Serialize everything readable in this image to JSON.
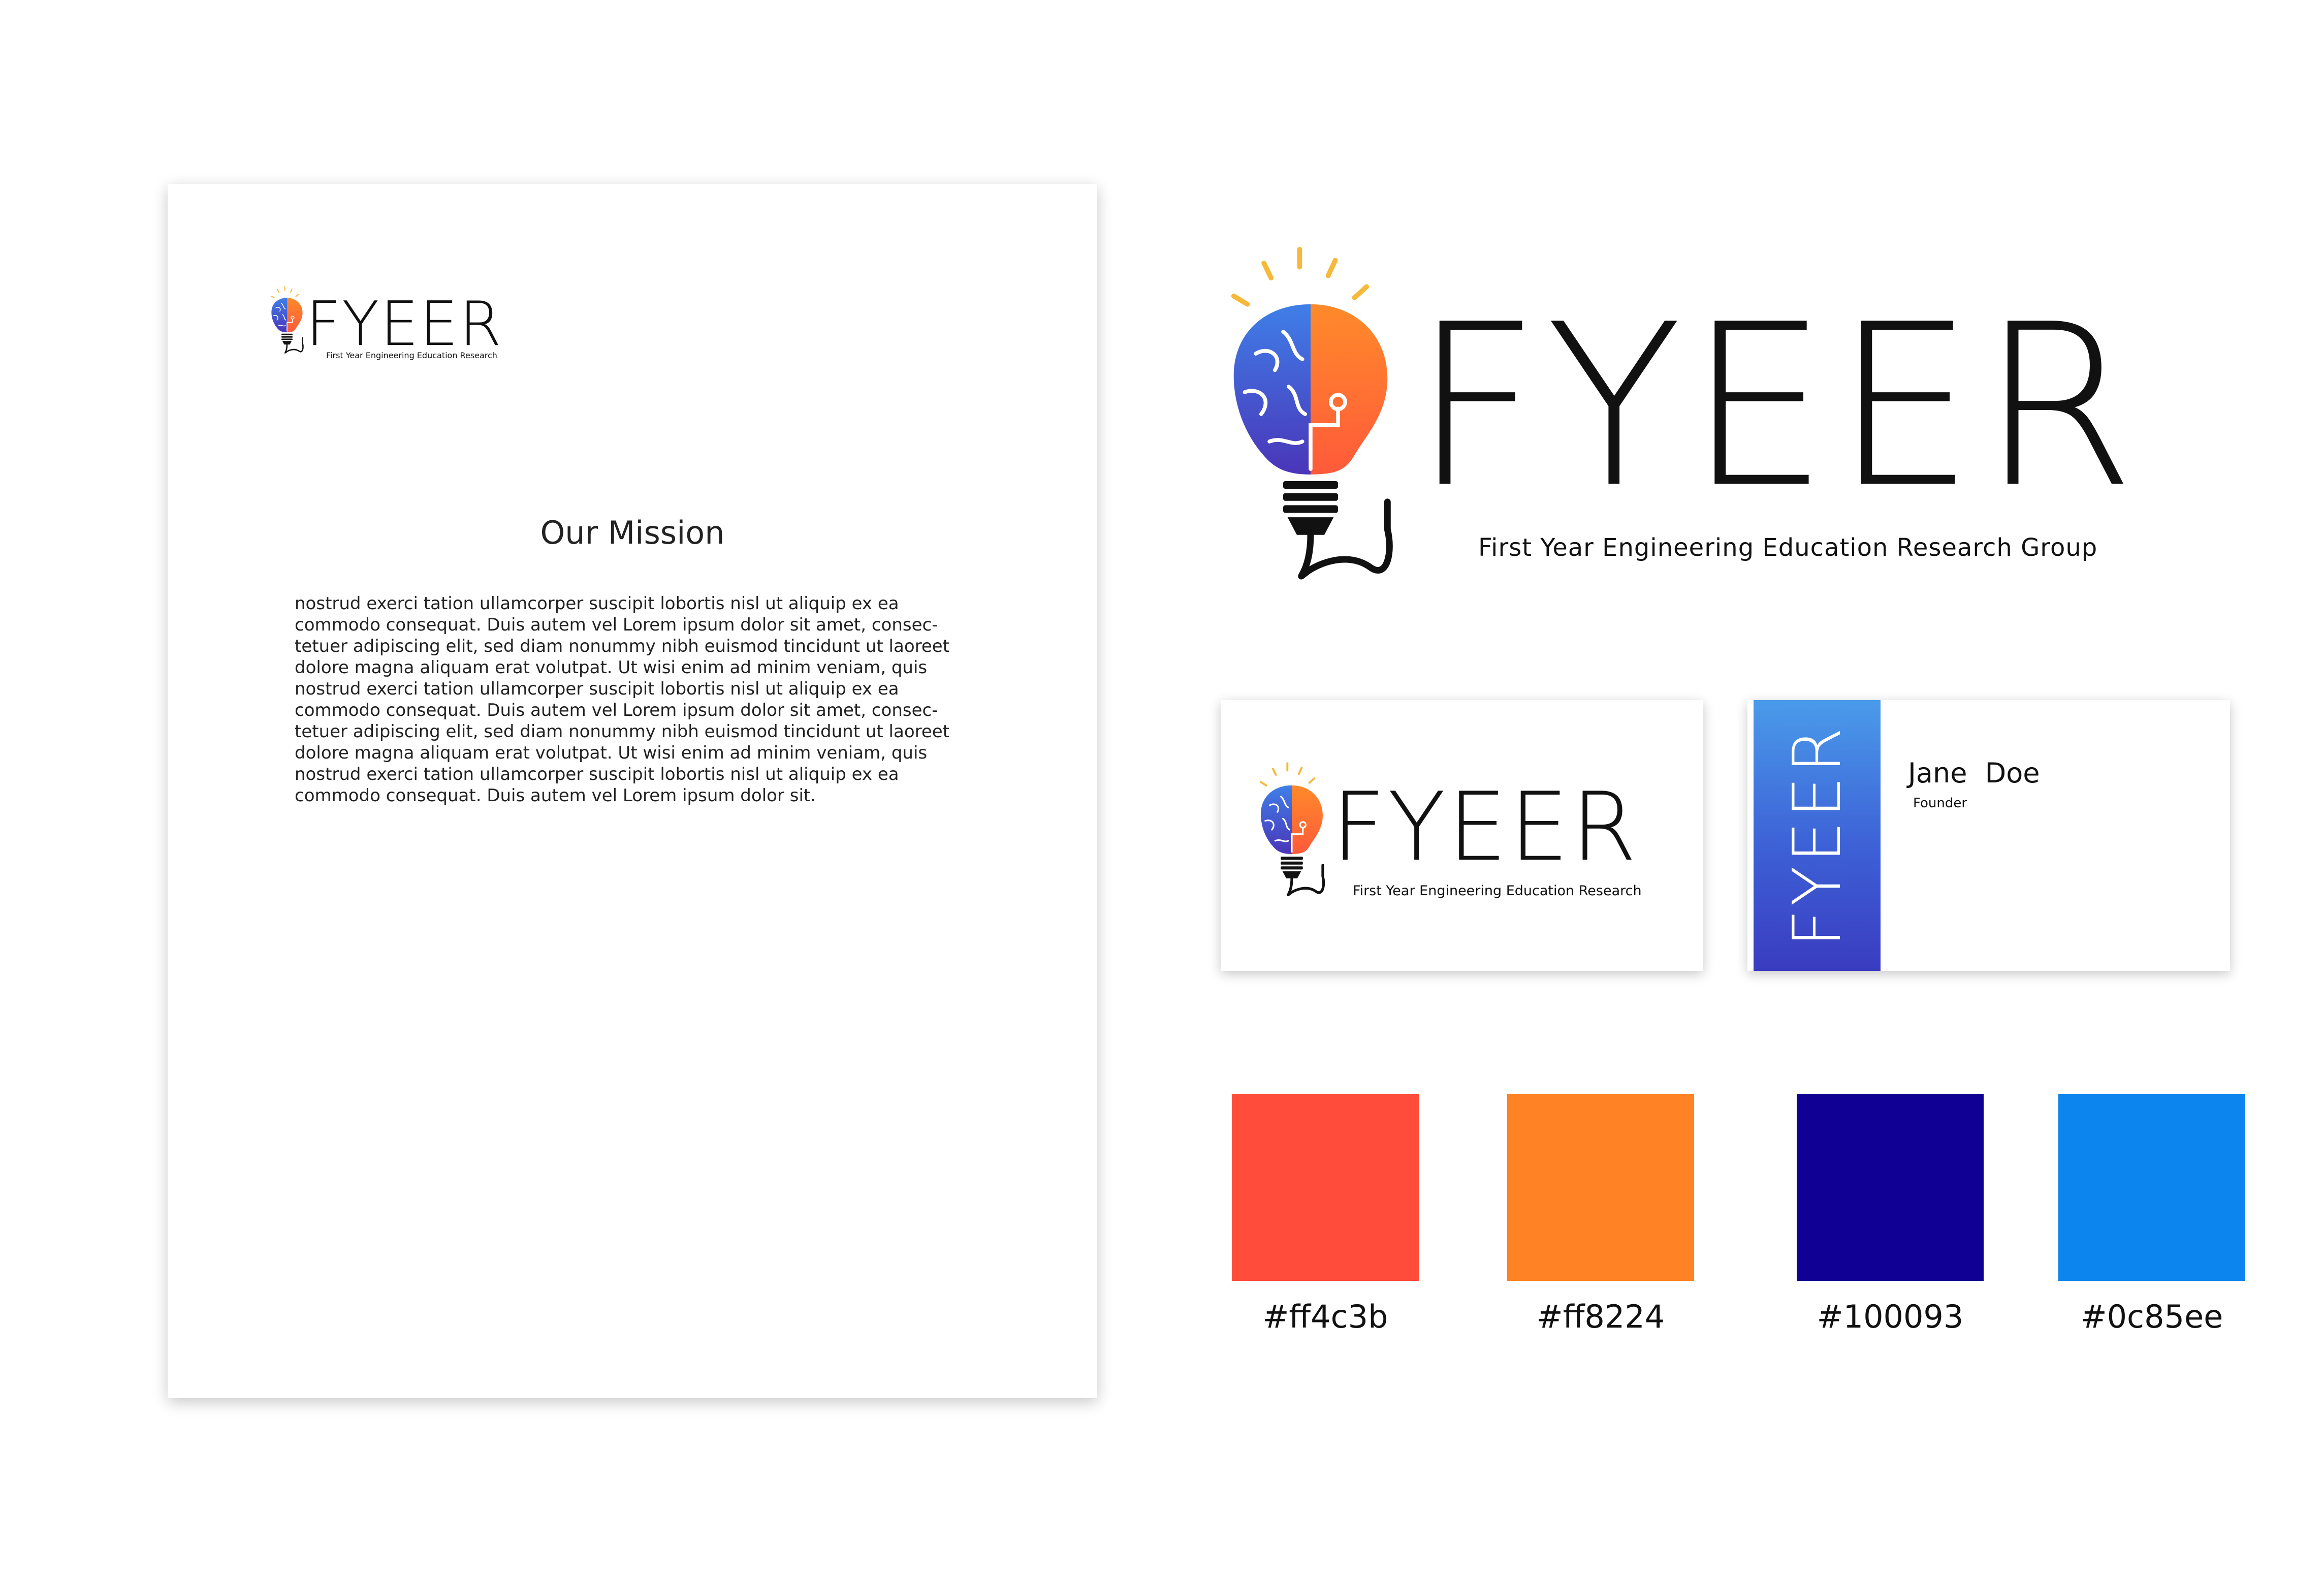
{
  "brand": {
    "logo_word": "FYEER",
    "tagline_full": "First Year Engineering Education Research Group",
    "tagline_short": "First Year Engineering Education Research"
  },
  "letterhead": {
    "title": "Our Mission",
    "body_lines": [
      "nostrud exerci tation ullamcorper suscipit lobortis nisl ut aliquip ex ea",
      "commodo consequat. Duis autem vel Lorem ipsum dolor sit amet, consec-",
      "tetuer adipiscing elit, sed diam nonummy nibh euismod tincidunt ut laoreet",
      "dolore magna aliquam erat volutpat. Ut wisi enim ad minim veniam, quis",
      "nostrud exerci tation ullamcorper suscipit lobortis nisl ut aliquip ex ea",
      "commodo consequat. Duis autem vel Lorem ipsum dolor sit amet, consec-",
      "tetuer adipiscing elit, sed diam nonummy nibh euismod tincidunt ut laoreet",
      "dolore magna aliquam erat volutpat. Ut wisi enim ad minim veniam, quis",
      "nostrud exerci tation ullamcorper suscipit lobortis nisl ut aliquip ex ea",
      "commodo consequat. Duis autem vel Lorem ipsum dolor sit."
    ]
  },
  "business_card": {
    "name": "Jane Doe",
    "role": "Founder"
  },
  "palette": [
    {
      "hex": "#ff4c3b",
      "label": "#ff4c3b"
    },
    {
      "hex": "#ff8224",
      "label": "#ff8224"
    },
    {
      "hex": "#100093",
      "label": "#100093"
    },
    {
      "hex": "#0c85ee",
      "label": "#0c85ee"
    }
  ],
  "icons": [
    "brain-bulb-icon"
  ]
}
